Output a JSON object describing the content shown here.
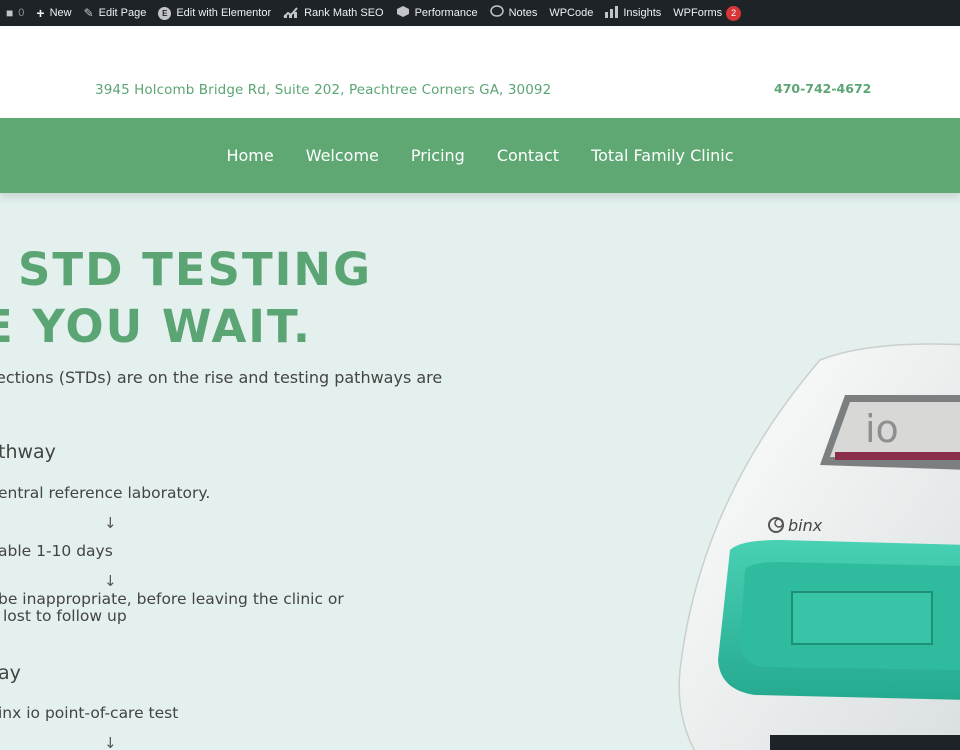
{
  "adminbar": {
    "comments_count": "0",
    "items": [
      {
        "icon": "plus-icon",
        "label": "New"
      },
      {
        "icon": "pencil-icon",
        "label": "Edit Page"
      },
      {
        "icon": "elementor-icon",
        "label": "Edit with Elementor"
      },
      {
        "icon": "rank-math-icon",
        "label": "Rank Math SEO"
      },
      {
        "icon": "performance-icon",
        "label": "Performance"
      },
      {
        "icon": "notes-icon",
        "label": "Notes"
      },
      {
        "icon": "",
        "label": "WPCode"
      },
      {
        "icon": "insights-icon",
        "label": "Insights"
      },
      {
        "icon": "",
        "label": "WPForms"
      }
    ],
    "wpforms_badge": "2"
  },
  "header": {
    "address": "3945 Holcomb Bridge Rd, Suite 202, Peachtree Corners GA, 30092",
    "phone": "470-742-4672"
  },
  "nav": {
    "items": [
      "Home",
      "Welcome",
      "Pricing",
      "Contact",
      "Total Family Clinic"
    ]
  },
  "hero": {
    "title_line1": "STD TESTING",
    "title_line2": "E YOU WAIT.",
    "intro": "ections (STDs) are on the rise and testing pathways are",
    "pathway1_heading": "thway",
    "pathway1_steps": [
      "entral reference laboratory.",
      "able 1-10 days",
      "be inappropriate, before leaving the clinic or",
      "lost to follow up"
    ],
    "arrow": "↓",
    "pathway2_heading": "ay",
    "pathway2_steps": [
      "inx io point-of-care test"
    ]
  },
  "device": {
    "brand": "binx",
    "screen_text": "io"
  },
  "colors": {
    "brand_green": "#5ba574",
    "nav_green": "#5fa874",
    "hero_bg": "#e3f0ee",
    "device_teal": "#3cc3a8"
  }
}
